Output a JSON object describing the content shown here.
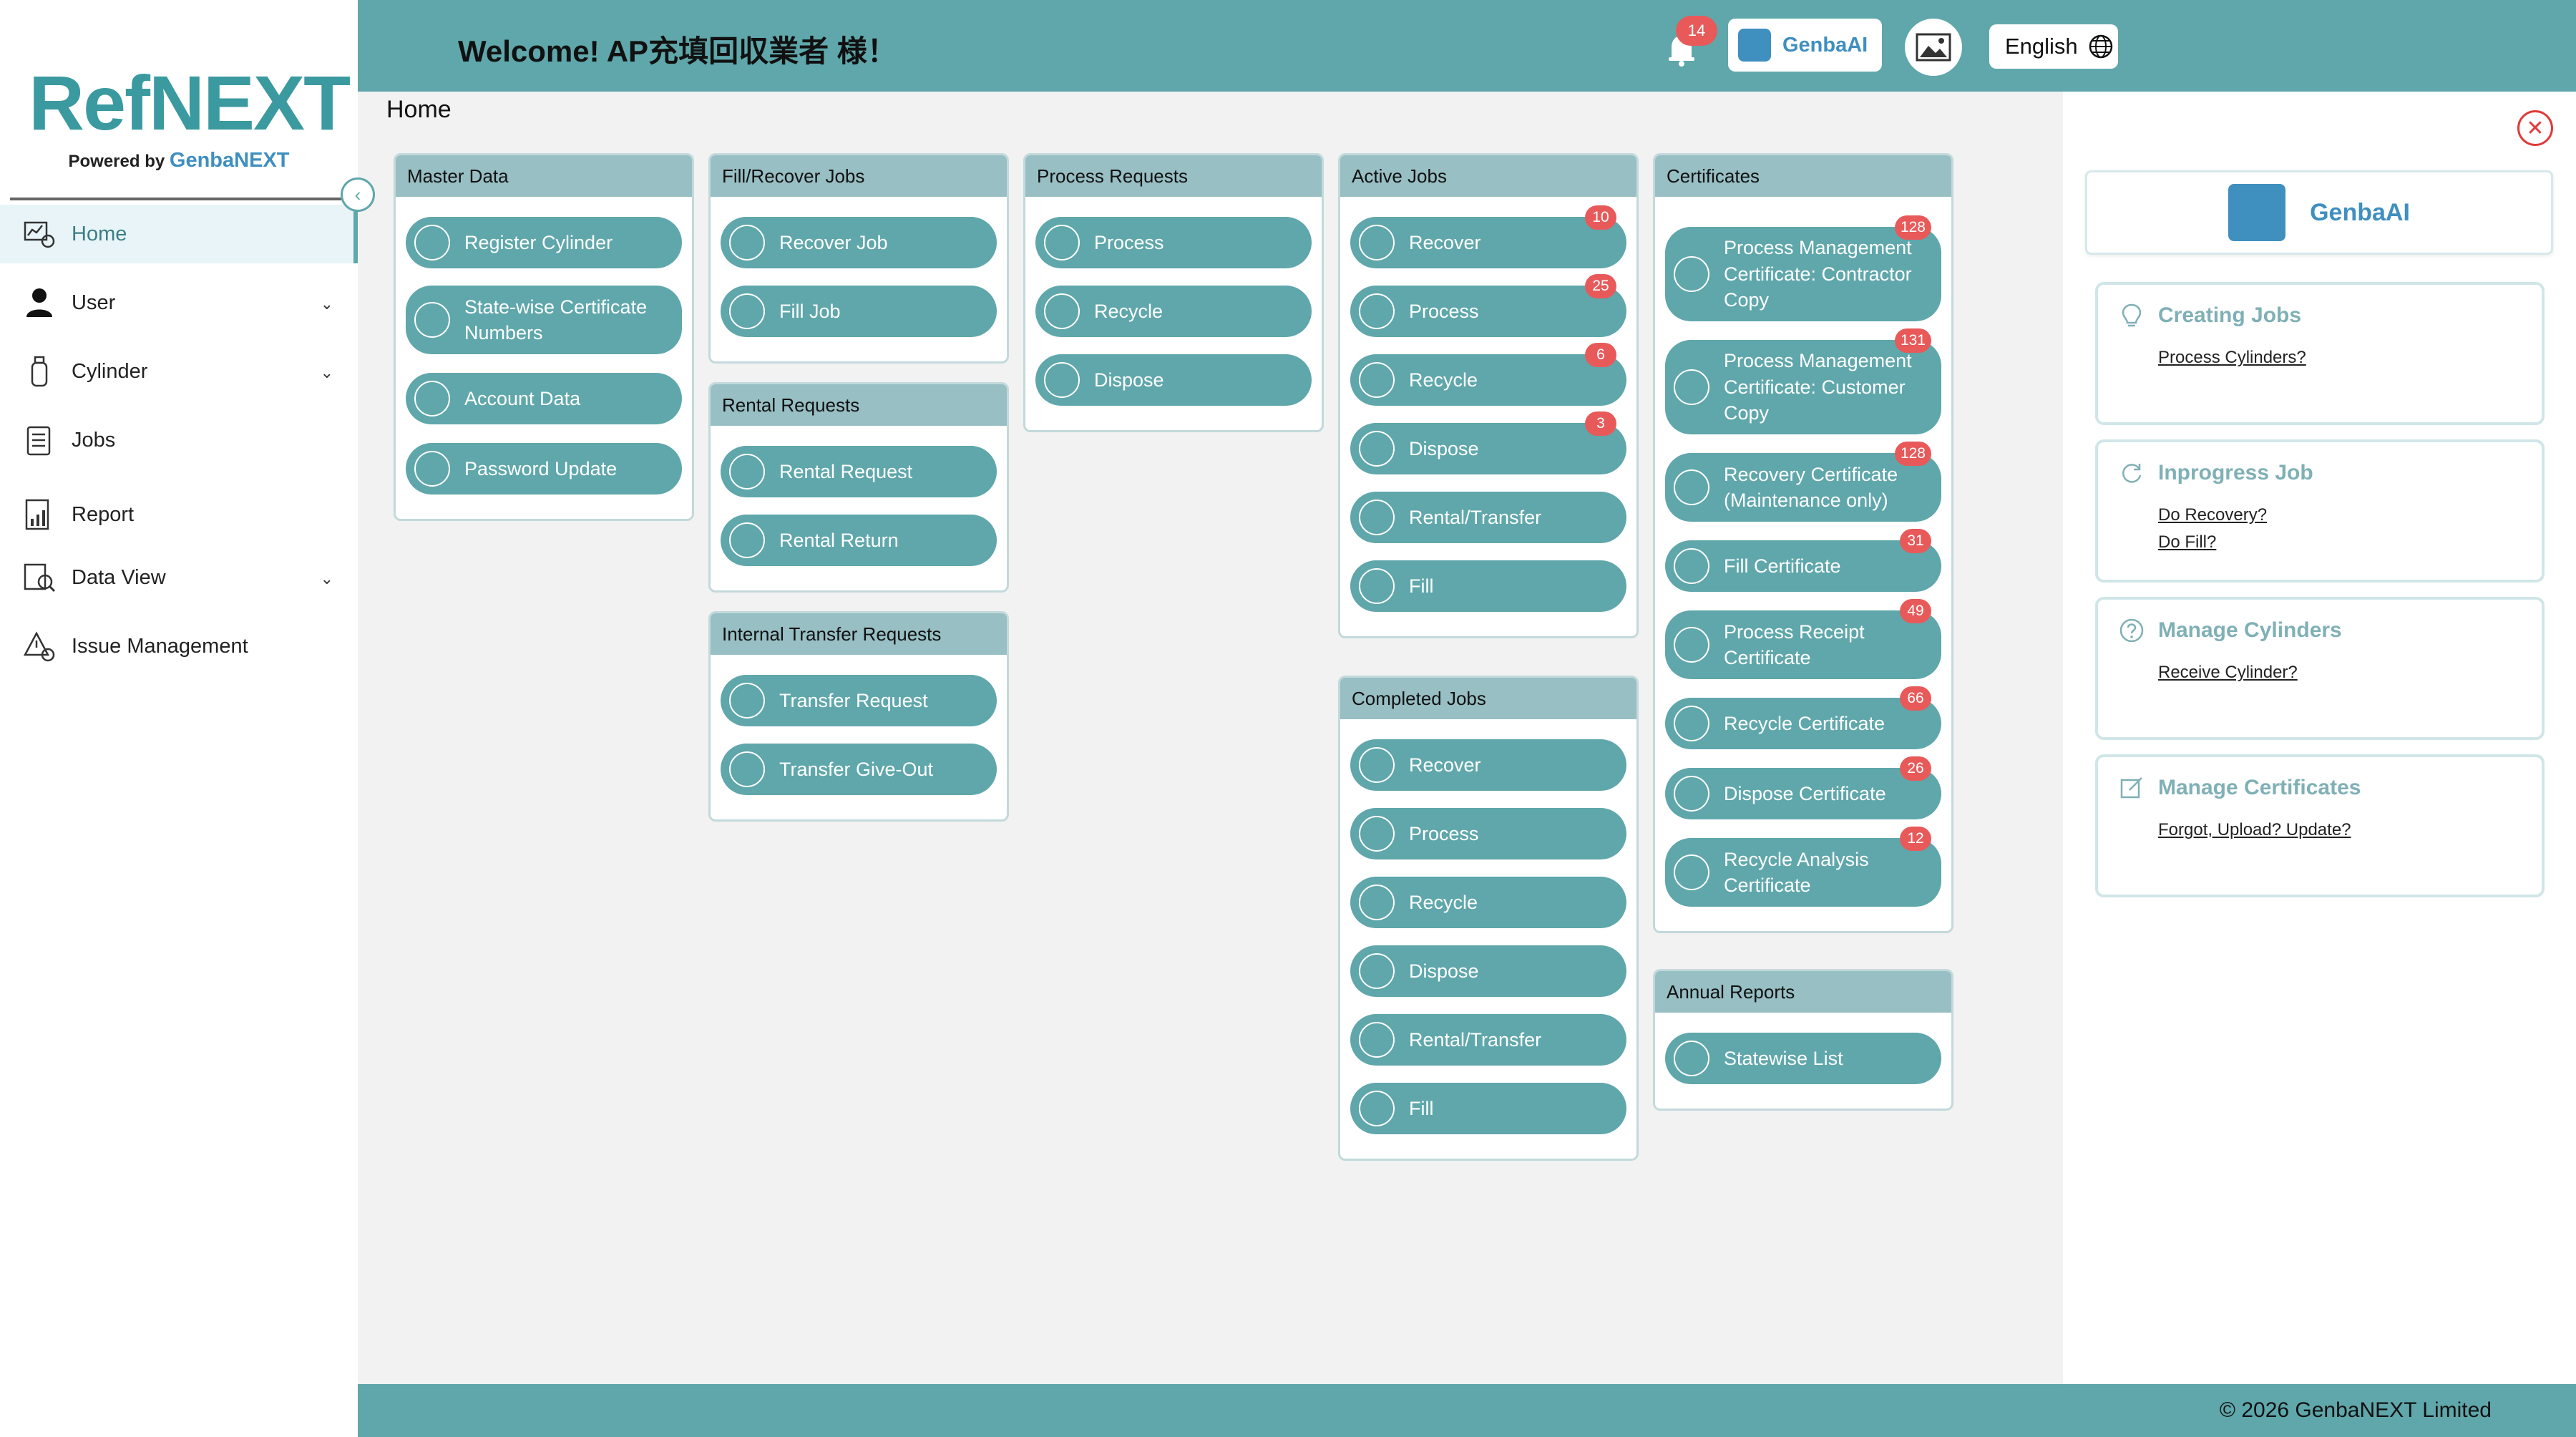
{
  "logo": {
    "main": "RefNEXT",
    "powered_by": "Powered by",
    "brand": "GenbaNEXT"
  },
  "sidebar": {
    "items": [
      {
        "label": "Home",
        "icon": "home-icon",
        "expandable": false,
        "active": true
      },
      {
        "label": "User",
        "icon": "user-icon",
        "expandable": true,
        "active": false
      },
      {
        "label": "Cylinder",
        "icon": "cylinder-icon",
        "expandable": true,
        "active": false
      },
      {
        "label": "Jobs",
        "icon": "jobs-icon",
        "expandable": false,
        "active": false
      },
      {
        "label": "Report",
        "icon": "report-icon",
        "expandable": false,
        "active": false
      },
      {
        "label": "Data View",
        "icon": "data-view-icon",
        "expandable": true,
        "active": false
      },
      {
        "label": "Issue Management",
        "icon": "issue-icon",
        "expandable": false,
        "active": false
      }
    ]
  },
  "header": {
    "welcome": "Welcome!  AP充填回収業者  様！",
    "notifications": "14",
    "genba_label": "GenbaAI",
    "language": "English"
  },
  "breadcrumb": "Home",
  "panels": {
    "master": {
      "title": "Master Data",
      "tiles": [
        {
          "label": "Register Cylinder"
        },
        {
          "label": "State-wise Certificate Numbers"
        },
        {
          "label": "Account Data"
        },
        {
          "label": "Password Update"
        }
      ]
    },
    "fill_recover": {
      "title": "Fill/Recover Jobs",
      "tiles": [
        {
          "label": "Recover Job"
        },
        {
          "label": "Fill Job"
        }
      ]
    },
    "rental": {
      "title": "Rental Requests",
      "tiles": [
        {
          "label": "Rental Request"
        },
        {
          "label": "Rental Return"
        }
      ]
    },
    "internal": {
      "title": "Internal Transfer Requests",
      "tiles": [
        {
          "label": "Transfer Request"
        },
        {
          "label": "Transfer Give-Out"
        }
      ]
    },
    "process_req": {
      "title": "Process Requests",
      "tiles": [
        {
          "label": "Process"
        },
        {
          "label": "Recycle"
        },
        {
          "label": "Dispose"
        }
      ]
    },
    "active": {
      "title": "Active Jobs",
      "tiles": [
        {
          "label": "Recover",
          "badge": "10"
        },
        {
          "label": "Process",
          "badge": "25"
        },
        {
          "label": "Recycle",
          "badge": "6"
        },
        {
          "label": "Dispose",
          "badge": "3"
        },
        {
          "label": "Rental/Transfer"
        },
        {
          "label": "Fill"
        }
      ]
    },
    "completed": {
      "title": "Completed Jobs",
      "tiles": [
        {
          "label": "Recover"
        },
        {
          "label": "Process"
        },
        {
          "label": "Recycle"
        },
        {
          "label": "Dispose"
        },
        {
          "label": "Rental/Transfer"
        },
        {
          "label": "Fill"
        }
      ]
    },
    "certificates": {
      "title": "Certificates",
      "tiles": [
        {
          "label": "Process Management Certificate: Contractor Copy",
          "badge": "128"
        },
        {
          "label": "Process Management Certificate: Customer Copy",
          "badge": "131"
        },
        {
          "label": "Recovery Certificate (Maintenance only)",
          "badge": "128"
        },
        {
          "label": "Fill Certificate",
          "badge": "31"
        },
        {
          "label": "Process Receipt Certificate",
          "badge": "49"
        },
        {
          "label": "Recycle Certificate",
          "badge": "66"
        },
        {
          "label": "Dispose Certificate",
          "badge": "26"
        },
        {
          "label": "Recycle Analysis Certificate",
          "badge": "12"
        }
      ]
    },
    "annual": {
      "title": "Annual Reports",
      "tiles": [
        {
          "label": "Statewise List"
        }
      ]
    }
  },
  "assistant": {
    "genba_label": "GenbaAI",
    "cards": [
      {
        "title": "Creating Jobs",
        "icon": "lightbulb-icon",
        "links": [
          "Process Cylinders?"
        ]
      },
      {
        "title": "Inprogress Job",
        "icon": "refresh-icon",
        "links": [
          "Do Recovery?",
          "Do Fill?"
        ]
      },
      {
        "title": "Manage Cylinders",
        "icon": "question-icon",
        "links": [
          "Receive Cylinder?"
        ]
      },
      {
        "title": "Manage Certificates",
        "icon": "edit-icon",
        "links": [
          "Forgot, Upload? Update?"
        ]
      }
    ]
  },
  "footer": {
    "copyright": "© 2026 GenbaNEXT Limited"
  },
  "colors": {
    "header": "#5fa7ab",
    "panel_head": "#97bfc4",
    "tile": "#5fa7ab",
    "badge": "#e85a5a",
    "brand_blue": "#3f8fbf"
  }
}
